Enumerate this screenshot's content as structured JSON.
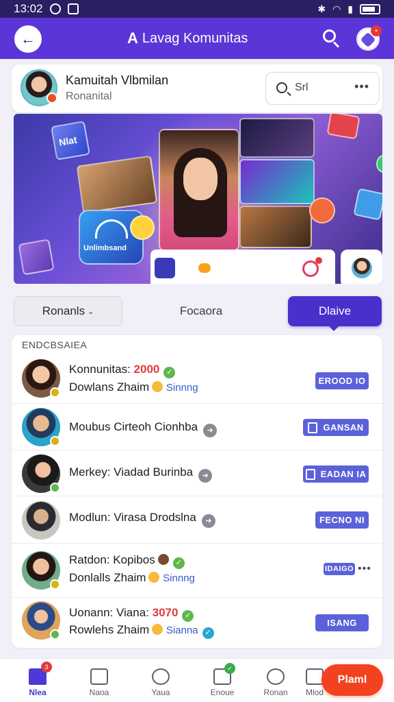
{
  "status": {
    "time": "13:02"
  },
  "app_bar": {
    "title_glyph": "A",
    "title": "Lavag Komunitas"
  },
  "community": {
    "name": "Kamuitah Vlbmilan",
    "subtitle": "Ronanital",
    "search_text": "Srl",
    "more": "•••"
  },
  "banner": {
    "tile_label": "Nlat",
    "card_label": "Unlimbsand"
  },
  "tabs": [
    {
      "label": "Ronanls",
      "active": false
    },
    {
      "label": "Focaora",
      "active": false
    },
    {
      "label": "Dlaive",
      "active": true
    }
  ],
  "list": {
    "header": "ENDCBSAIEA",
    "rows": [
      {
        "line1": "Konnunitas:",
        "accent": "2000",
        "line2": "Dowlans Zhaim",
        "tag": "Sinnng",
        "action": "EROOD IO"
      },
      {
        "line1": "Moubus Cirteoh Cionhba",
        "accent": "",
        "line2": "",
        "tag": "",
        "action": "GANSAN"
      },
      {
        "line1": "Merkey: Viadad Burinba",
        "accent": "",
        "line2": "",
        "tag": "",
        "action": "EADAN IA"
      },
      {
        "line1": "Modlun: Virasa Drodslna",
        "accent": "",
        "line2": "",
        "tag": "",
        "action": "FECNO NI"
      },
      {
        "line1": "Ratdon: Kopibos",
        "accent": "",
        "line2": "Donlalls Zhaim",
        "tag": "Sinnng",
        "action": "IDAIGO"
      },
      {
        "line1": "Uonann: Viana:",
        "accent": "3070",
        "line2": "Rowlehs Zhaim",
        "tag": "Sianna",
        "action": "ISANG"
      }
    ]
  },
  "bottom_nav": [
    {
      "label": "Nlea",
      "active": true,
      "badge": "3"
    },
    {
      "label": "Naoa",
      "active": false,
      "badge": ""
    },
    {
      "label": "Yaua",
      "active": false,
      "badge": ""
    },
    {
      "label": "Enoue",
      "active": false,
      "badge": ""
    },
    {
      "label": "Ronan",
      "active": false,
      "badge": ""
    },
    {
      "label": "Mlod",
      "active": false,
      "badge": ""
    }
  ],
  "fab": {
    "label": "Plaml"
  },
  "colors": {
    "app_bar": "#5b35d8",
    "status_bar": "#2a1f63",
    "active_tab": "#4b2fcd",
    "action_button": "#5b62d9",
    "fab": "#f2421f",
    "accent_red": "#e23a3a"
  }
}
